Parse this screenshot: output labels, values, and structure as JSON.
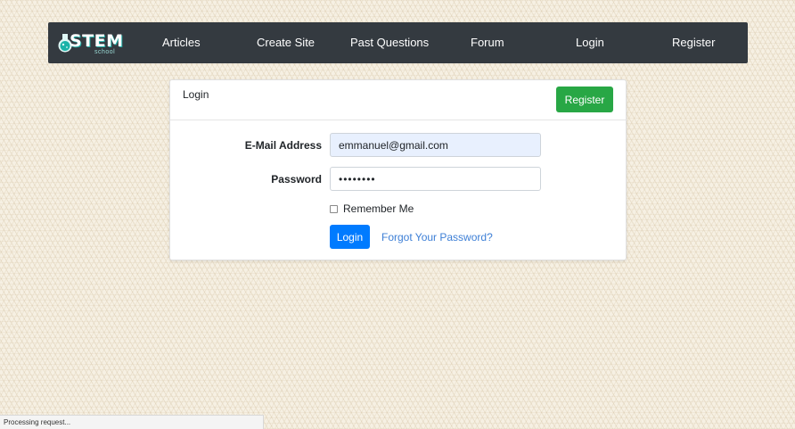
{
  "navbar": {
    "logo": {
      "title": "STEM",
      "subtitle": "school",
      "icon": "flask-icon"
    },
    "links": [
      {
        "label": "Articles"
      },
      {
        "label": "Create Site"
      },
      {
        "label": "Past Questions"
      },
      {
        "label": "Forum"
      },
      {
        "label": "Login"
      },
      {
        "label": "Register"
      }
    ]
  },
  "card": {
    "title": "Login",
    "register_button": "Register",
    "email": {
      "label": "E-Mail Address",
      "value": "emmanuel@gmail.com"
    },
    "password": {
      "label": "Password",
      "value": "••••••••"
    },
    "remember_label": "Remember Me",
    "remember_checked": false,
    "login_button": "Login",
    "forgot_link": "Forgot Your Password?"
  },
  "status_bar": {
    "text": "Processing request..."
  },
  "colors": {
    "navbar": "#343a40",
    "register_green": "#28a745",
    "login_blue": "#007bff",
    "link_blue": "#3d7fd6",
    "autofill": "#e8f0fe"
  }
}
